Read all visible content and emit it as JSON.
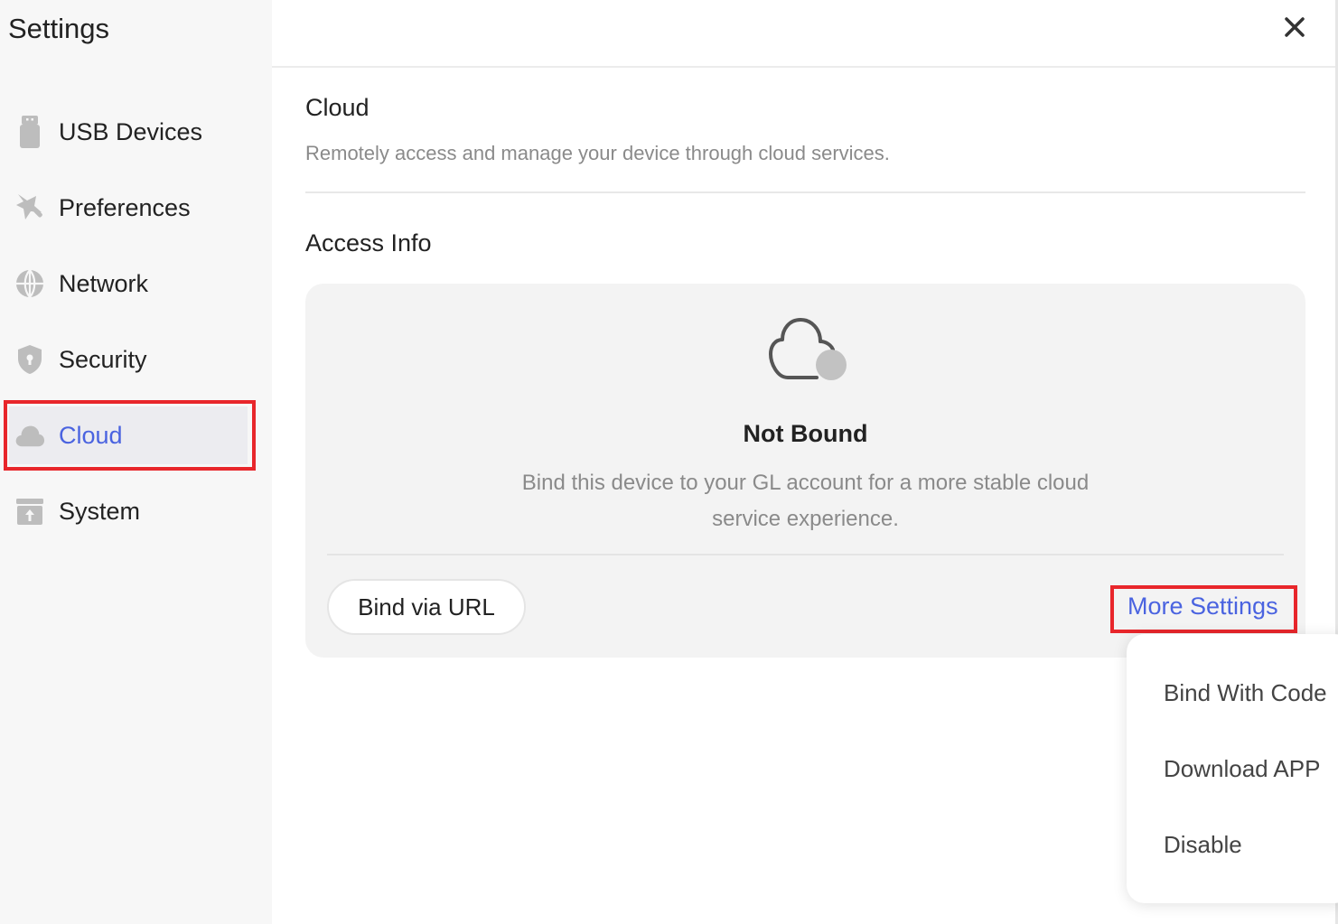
{
  "sidebar": {
    "title": "Settings",
    "items": [
      {
        "label": "USB Devices",
        "icon": "usb-icon"
      },
      {
        "label": "Preferences",
        "icon": "preferences-icon"
      },
      {
        "label": "Network",
        "icon": "globe-icon"
      },
      {
        "label": "Security",
        "icon": "shield-icon"
      },
      {
        "label": "Cloud",
        "icon": "cloud-icon",
        "active": true
      },
      {
        "label": "System",
        "icon": "system-icon"
      }
    ]
  },
  "header": {
    "close_icon": "close-icon"
  },
  "main": {
    "title": "Cloud",
    "description": "Remotely access and manage your device through cloud services.",
    "access_info": {
      "title": "Access Info",
      "status_icon": "cloud-offline-icon",
      "status_title": "Not Bound",
      "status_desc": "Bind this device to your GL account for a more stable cloud service experience.",
      "bind_button_label": "Bind via URL",
      "more_settings_label": "More Settings"
    }
  },
  "dropdown": {
    "items": [
      "Bind With Code",
      "Download APP",
      "Disable"
    ]
  },
  "colors": {
    "accent": "#4a63e0",
    "highlight": "#e8262b",
    "sidebar_bg": "#f7f7f7",
    "card_bg": "#f3f3f3"
  }
}
